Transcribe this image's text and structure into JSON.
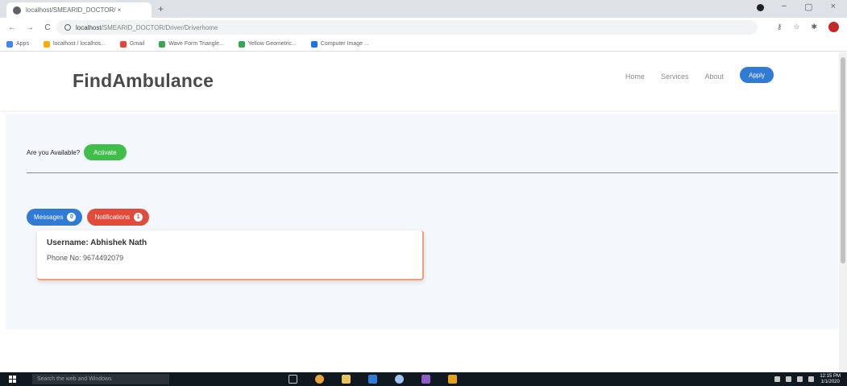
{
  "browser": {
    "tab_title": "localhost/SMEARID_DOCTOR/ ×",
    "tab_close": "×",
    "new_tab": "+",
    "url_host": "localhost",
    "url_path": "/SMEARID_DOCTOR/Driver/Driverhome",
    "nav": {
      "back": "←",
      "forward": "→",
      "reload": "C"
    },
    "window_controls": {
      "minimize": "−",
      "maximize": "▢",
      "close": "×"
    },
    "toolbar_icons": {
      "key": "⚷",
      "star": "☆",
      "extensions": "✱"
    },
    "bookmarks": [
      {
        "label": "Apps",
        "color": "#4285f4"
      },
      {
        "label": "localhost / localhos...",
        "color": "#f9ab00"
      },
      {
        "label": "Gmail",
        "color": "#ea4335"
      },
      {
        "label": "Wave Form Triangle...",
        "color": "#34a853"
      },
      {
        "label": "Yellow Geometric...",
        "color": "#34a853"
      },
      {
        "label": "Computer Image ...",
        "color": "#1a73e8"
      }
    ]
  },
  "app": {
    "brand": "FindAmbulance",
    "nav": {
      "home": "Home",
      "services": "Services",
      "about": "About",
      "apply": "Apply"
    },
    "availability": {
      "label": "Are you Available?",
      "activate": "Activate"
    },
    "tabs": {
      "messages": "Messages",
      "messages_count": "0",
      "notifications": "Notifications",
      "notifications_count": "1"
    },
    "card": {
      "username": "Username: Abhishek Nath",
      "phone": "Phone No: 9674492079"
    }
  },
  "taskbar": {
    "search_placeholder": "Search the web and Windows",
    "time": "12:15 PM",
    "date": "1/1/2020"
  },
  "colors": {
    "primary": "#2f7bd6",
    "success": "#3fbf4a",
    "danger": "#e24a3b",
    "card_border": "#f0a070",
    "content_bg": "#f4f7fc"
  }
}
